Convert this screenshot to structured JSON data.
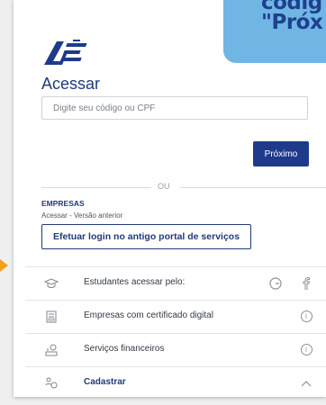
{
  "callout": {
    "line1": "códig",
    "line2": "\"Próx"
  },
  "login": {
    "title": "Acessar",
    "input_placeholder": "Digite seu código ou CPF",
    "next_label": "Próximo"
  },
  "divider": {
    "text": "OU"
  },
  "empresas": {
    "label": "EMPRESAS",
    "sublabel": "Acessar - Versão anterior",
    "old_portal_label": "Efetuar login no antigo portal de serviços"
  },
  "rows": [
    {
      "label": "Estudantes acessar pelo:",
      "icon": "graduation-cap-icon"
    },
    {
      "label": "Empresas com certificado digital",
      "icon": "certificate-icon"
    },
    {
      "label": "Serviços financeiros",
      "icon": "finance-icon"
    },
    {
      "label": "Cadastrar",
      "icon": "register-icon"
    }
  ],
  "colors": {
    "primary": "#1f3a8a",
    "callout": "#6fb6e4",
    "arrow": "#f2a019"
  }
}
